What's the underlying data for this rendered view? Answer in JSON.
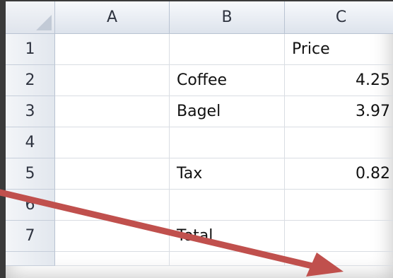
{
  "columns": {
    "a": "A",
    "b": "B",
    "c": "C"
  },
  "rows": {
    "r1": "1",
    "r2": "2",
    "r3": "3",
    "r4": "4",
    "r5": "5",
    "r6": "6",
    "r7": "7"
  },
  "cells": {
    "c1": "Price",
    "b2": "Coffee",
    "c2": "4.25",
    "b3": "Bagel",
    "c3": "3.97",
    "b5": "Tax",
    "c5": "0.82",
    "b7": "Total"
  },
  "colors": {
    "arrow": "#c0504d"
  },
  "icons": {
    "select_all": "select-all-triangle-icon",
    "arrow": "arrow-annotation-icon"
  }
}
